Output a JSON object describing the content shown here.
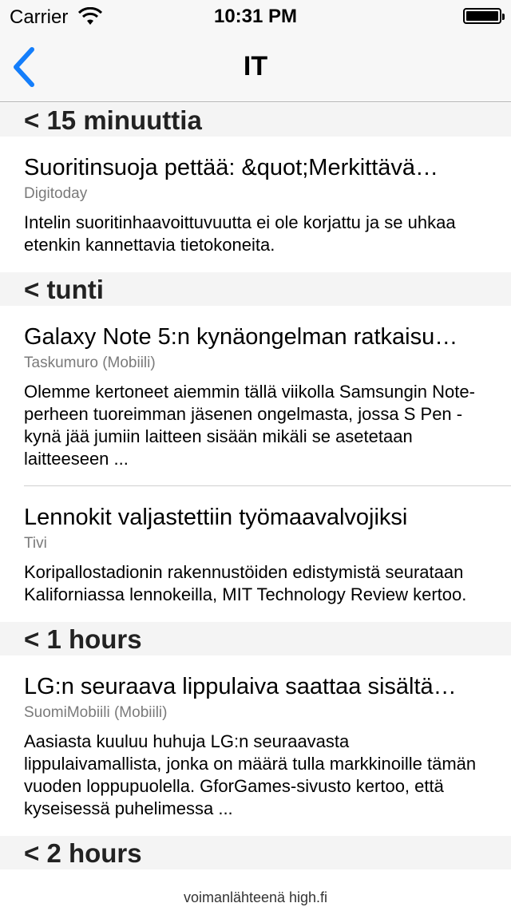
{
  "status_bar": {
    "carrier": "Carrier",
    "time": "10:31 PM",
    "icons": [
      "wifi-icon",
      "battery-icon"
    ]
  },
  "nav": {
    "title": "IT",
    "back_icon": "chevron-left-icon",
    "accent_color": "#147efb"
  },
  "sections": [
    {
      "header": "< 15 minuuttia",
      "articles": [
        {
          "title": "Suoritinsuoja pettää: &quot;Merkittävä…",
          "source": "Digitoday",
          "summary": "Intelin suoritinhaavoittuvuutta ei ole korjattu ja se uhkaa etenkin kannettavia tietokoneita."
        }
      ]
    },
    {
      "header": "< tunti",
      "articles": [
        {
          "title": "Galaxy Note 5:n kynäongelman ratkaisu…",
          "source": "Taskumuro (Mobiili)",
          "summary": "Olemme kertoneet aiemmin tällä viikolla Samsungin Note-perheen tuoreimman jäsenen ongelmasta, jossa S Pen -kynä jää jumiin laitteen sisään mikäli se asetetaan laitteeseen ..."
        },
        {
          "title": "Lennokit valjastettiin työmaavalvojiksi",
          "source": "Tivi",
          "summary": "Koripallostadionin rakennustöiden edistymistä seurataan Kaliforniassa lennokeilla, MIT Technology Review kertoo."
        }
      ]
    },
    {
      "header": "< 1 hours",
      "articles": [
        {
          "title": "LG:n seuraava lippulaiva saattaa sisältä…",
          "source": "SuomiMobiili (Mobiili)",
          "summary": "Aasiasta kuuluu huhuja LG:n seuraavasta lippulaivamallista, jonka on määrä tulla markkinoille tämän vuoden loppupuolella. GforGames-sivusto kertoo, että kyseisessä puhelimessa ..."
        }
      ]
    },
    {
      "header": "< 2 hours",
      "articles": []
    }
  ],
  "footer": {
    "text": "voimanlähteenä high.fi"
  }
}
